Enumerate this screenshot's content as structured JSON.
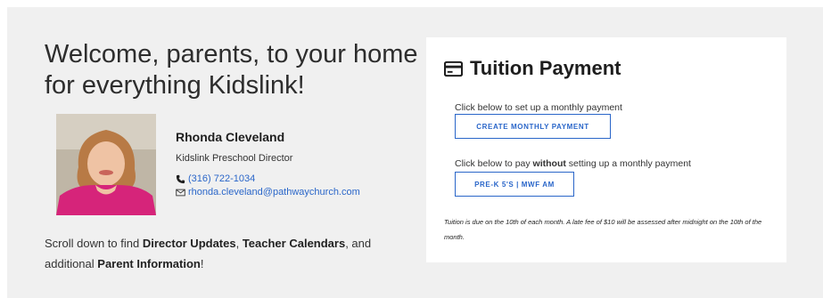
{
  "welcome": {
    "heading": "Welcome, parents, to your home for everything Kidslink!"
  },
  "director": {
    "name": "Rhonda Cleveland",
    "role": "Kidslink Preschool Director",
    "phone": "(316) 722-1034",
    "email": "rhonda.cleveland@pathwaychurch.com",
    "phone_icon": "phone-icon",
    "email_icon": "envelope-icon"
  },
  "scroll_note": {
    "t1": "Scroll down to find ",
    "b1": "Director Updates",
    "t2": ", ",
    "b2": "Teacher Calendars",
    "t3": ", and additional ",
    "b3": "Parent Information",
    "t4": "!"
  },
  "tuition": {
    "title": "Tuition Payment",
    "title_icon": "credit-card-icon",
    "monthly_label": "Click below to set up a monthly payment",
    "monthly_button": "CREATE MONTHLY PAYMENT",
    "onetime_label_1": "Click below to pay ",
    "onetime_label_bold": "without",
    "onetime_label_2": " setting up a monthly payment",
    "onetime_button": "PRE-K 5'S | MWF AM",
    "note": "Tuition is due on the 10th of each month. A late fee of $10 will be assessed after midnight on the 10th of the month."
  },
  "colors": {
    "panel_bg": "#f0f0f0",
    "accent": "#2a66c9",
    "card_bg": "#ffffff"
  }
}
